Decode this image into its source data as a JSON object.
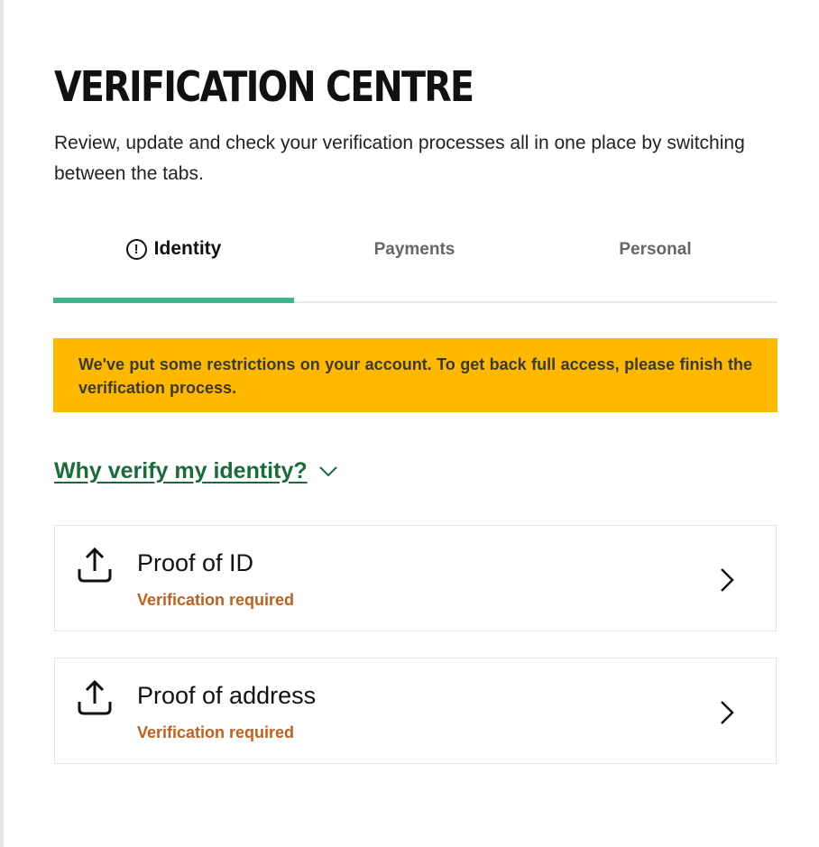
{
  "header": {
    "title": "VERIFICATION CENTRE",
    "subtitle": "Review, update and check your verification processes all in one place by switching between the tabs."
  },
  "tabs": [
    {
      "label": "Identity",
      "active": true,
      "icon": "alert-circle-icon"
    },
    {
      "label": "Payments",
      "active": false
    },
    {
      "label": "Personal",
      "active": false
    }
  ],
  "banner": {
    "text": "We've put some restrictions on your account. To get back full access, please finish the verification process.",
    "color": "#ffb800"
  },
  "why_link": {
    "label": "Why verify my identity?",
    "icon": "chevron-down-icon"
  },
  "documents": [
    {
      "title": "Proof of ID",
      "status": "Verification required",
      "icon": "upload-icon"
    },
    {
      "title": "Proof of address",
      "status": "Verification required",
      "icon": "upload-icon"
    }
  ],
  "colors": {
    "accent": "#3bb68a",
    "link": "#1a6b3a",
    "status_warning": "#c0601e"
  }
}
